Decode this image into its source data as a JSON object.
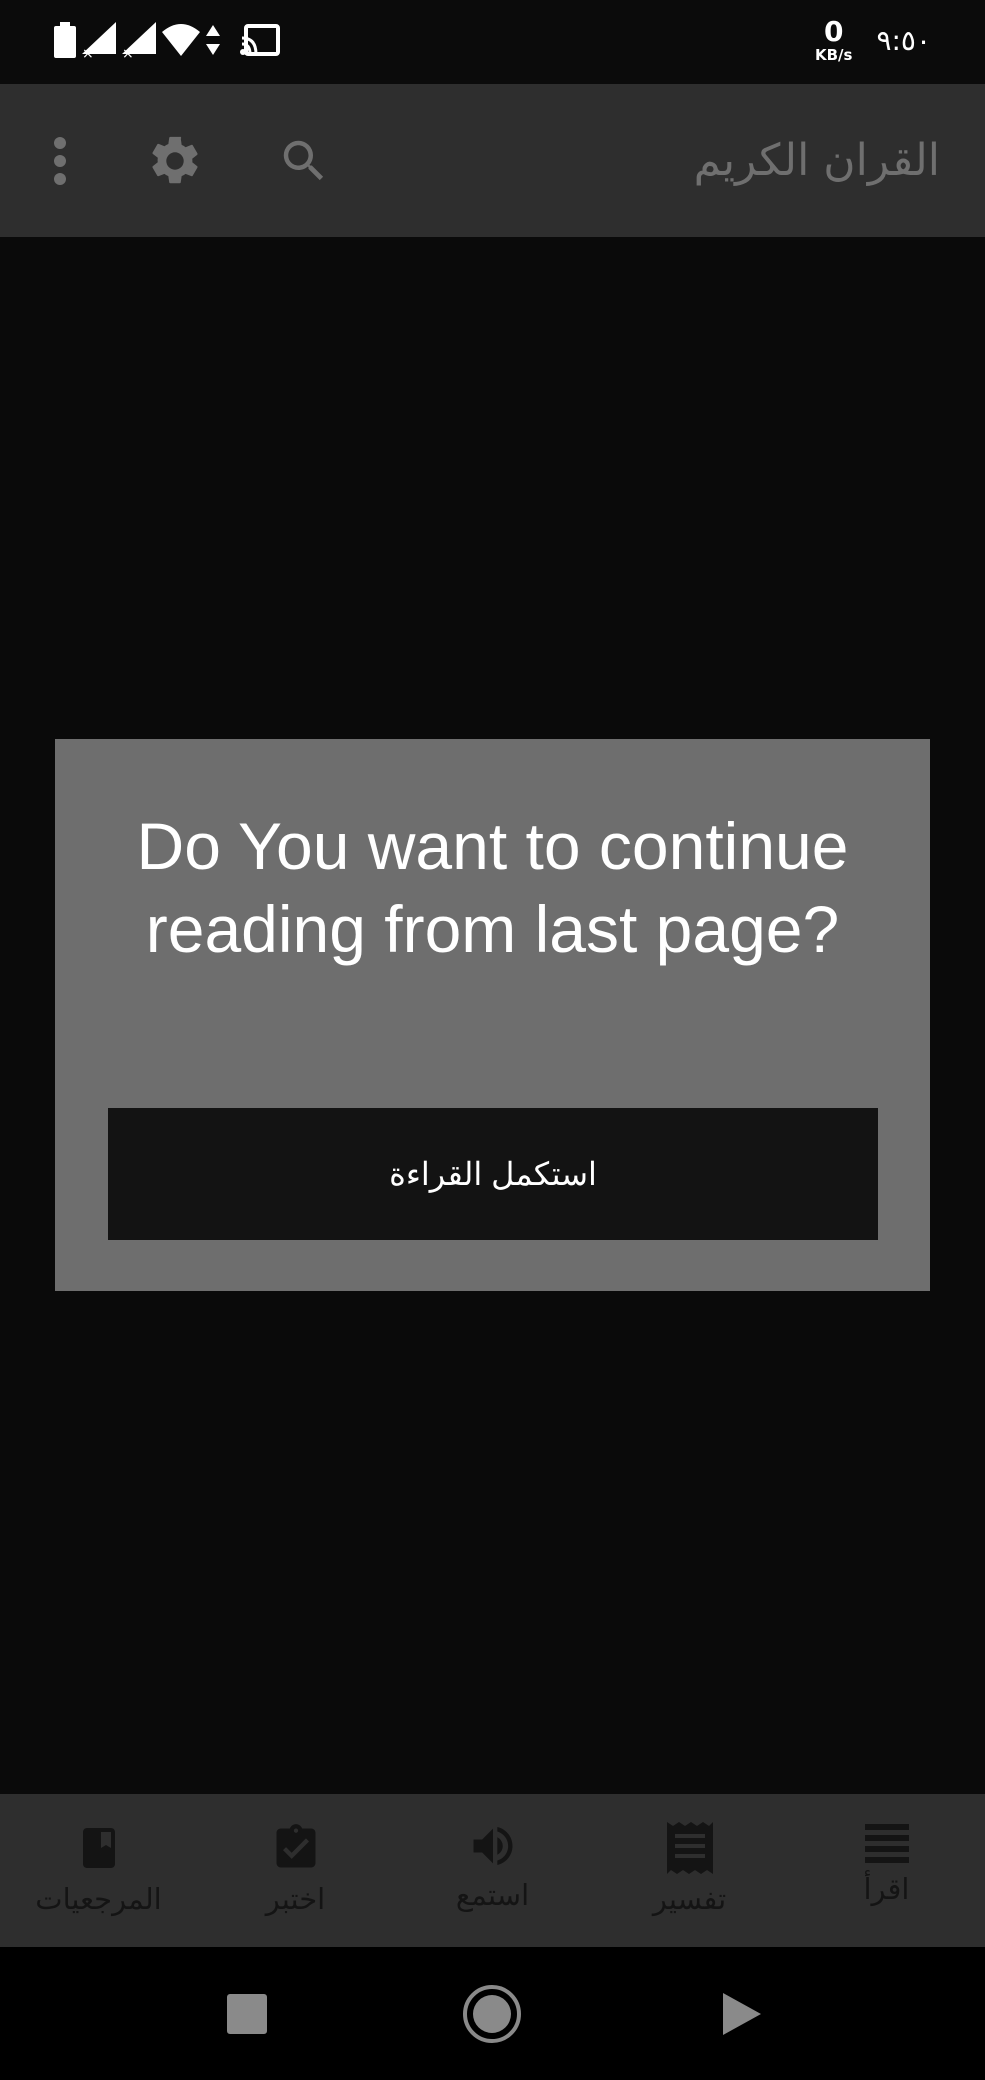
{
  "status_bar": {
    "speed_value": "0",
    "speed_unit": "KB/s",
    "time": "٩:٥٠",
    "icons": [
      "battery-icon",
      "signal-no-service-icon",
      "signal-no-service-icon",
      "wifi-icon",
      "data-arrows-icon",
      "cast-icon"
    ]
  },
  "app_bar": {
    "title": "القران الكريم",
    "actions": [
      "search-icon",
      "gear-icon",
      "more-vert-icon"
    ]
  },
  "dialog": {
    "message": "Do You want to continue reading from last page?",
    "button_label": "استكمل القراءة"
  },
  "bottom_nav": {
    "items": [
      {
        "label": "اقرأ",
        "icon": "list-lines-icon"
      },
      {
        "label": "تفسير",
        "icon": "receipt-icon"
      },
      {
        "label": "استمع",
        "icon": "speaker-icon"
      },
      {
        "label": "اختبر",
        "icon": "clipboard-check-icon"
      },
      {
        "label": "المرجعيات",
        "icon": "book-icon"
      }
    ]
  },
  "colors": {
    "background": "#0a0a0a",
    "app_bar": "#2e2e2e",
    "dialog": "#6e6e6e",
    "dialog_button": "#131313",
    "title_text": "#6f6f6f"
  }
}
